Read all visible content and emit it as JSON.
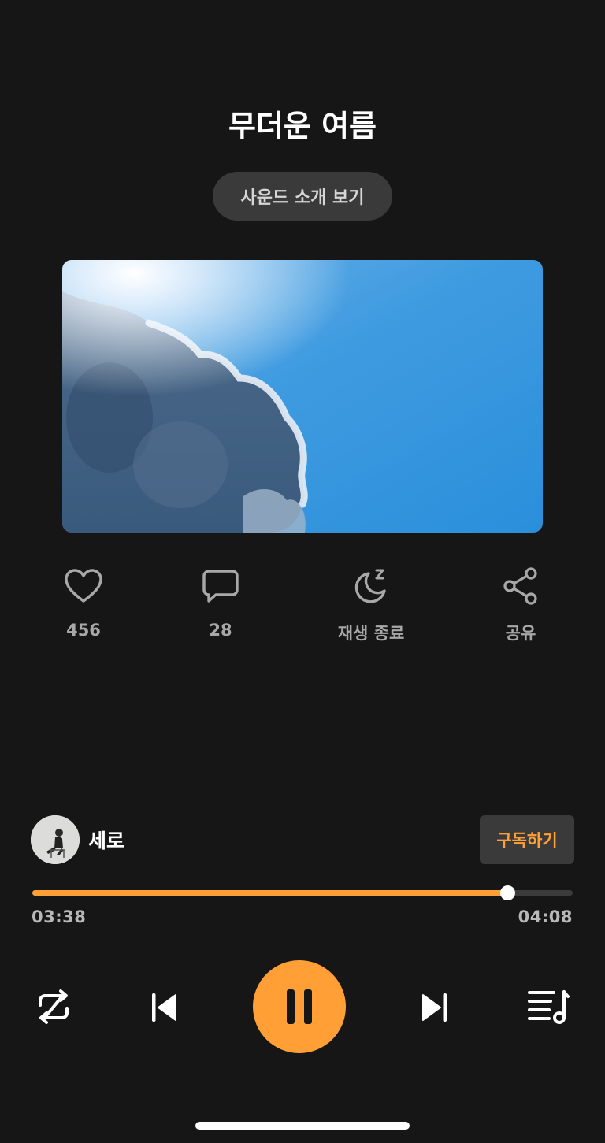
{
  "title": "무더운 여름",
  "intro_button": "사운드 소개 보기",
  "actions": {
    "likes": "456",
    "comments": "28",
    "sleep_timer": "재생 종료",
    "share": "공유"
  },
  "artist": {
    "name": "세로",
    "subscribe_label": "구독하기"
  },
  "playback": {
    "current_time": "03:38",
    "total_time": "04:08",
    "progress_fraction": 0.879
  },
  "colors": {
    "accent": "#ff9f35",
    "background": "#161616",
    "button_bg": "#3a3a3a"
  },
  "icons": {
    "like": "heart-icon",
    "comment": "comment-icon",
    "sleep": "moon-sleep-icon",
    "share": "share-icon",
    "repeat": "repeat-icon",
    "previous": "skip-previous-icon",
    "pause": "pause-icon",
    "next": "skip-next-icon",
    "playlist": "playlist-icon"
  }
}
